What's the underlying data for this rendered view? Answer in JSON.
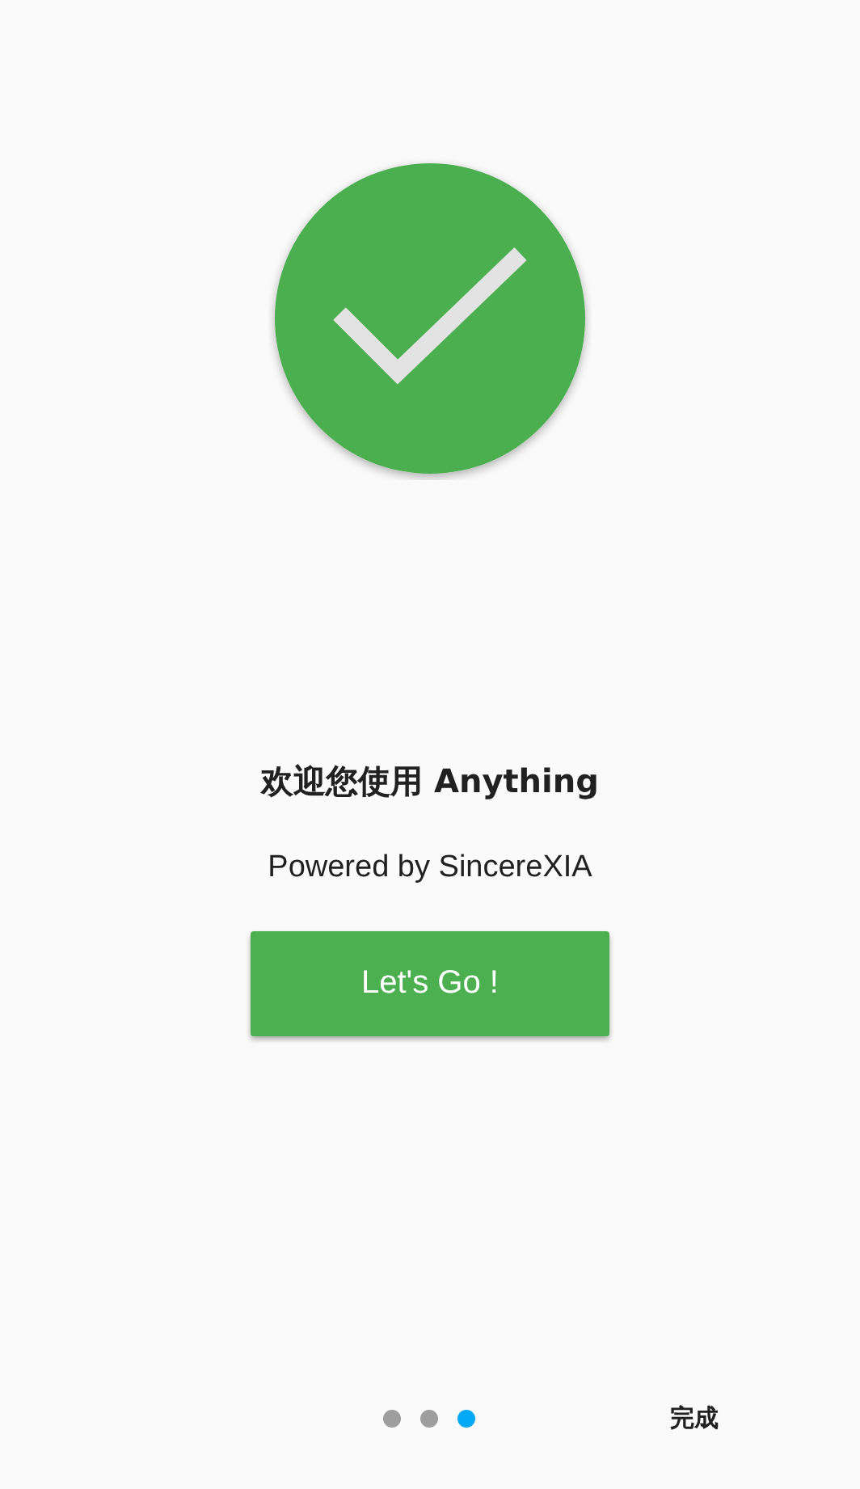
{
  "title": "欢迎您使用 Anything",
  "subtitle": "Powered by SincereXIA",
  "button": "Let's Go !",
  "page_indicator": [
    {
      "selected": false
    },
    {
      "selected": false
    },
    {
      "selected": true
    }
  ],
  "done_button": "完成"
}
